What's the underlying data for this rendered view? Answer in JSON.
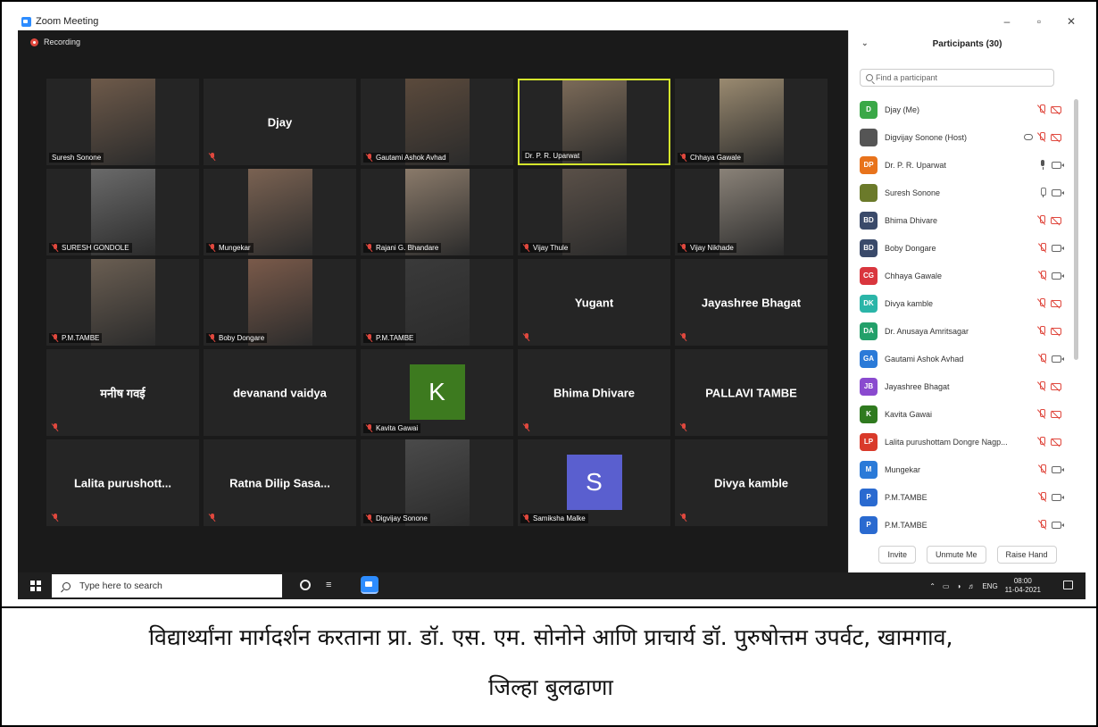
{
  "window": {
    "title": "Zoom Meeting",
    "controls": [
      "–",
      "▫",
      "✕"
    ]
  },
  "recording_label": "Recording",
  "tiles": [
    {
      "label": "Suresh Sonone",
      "big": "",
      "mic_muted": false,
      "active": false,
      "kind": "photo",
      "photo_color": "#6e5a4a"
    },
    {
      "label": "",
      "big": "Djay",
      "mic_muted": true,
      "active": false,
      "kind": "name"
    },
    {
      "label": "Gautami Ashok Avhad",
      "big": "",
      "mic_muted": true,
      "active": false,
      "kind": "photo",
      "photo_color": "#5b4a3c"
    },
    {
      "label": "Dr. P. R. Uparwat",
      "big": "",
      "mic_muted": false,
      "active": true,
      "kind": "photo",
      "photo_color": "#7b6a58"
    },
    {
      "label": "Chhaya Gawale",
      "big": "",
      "mic_muted": true,
      "active": false,
      "kind": "photo",
      "photo_color": "#9a8a70"
    },
    {
      "label": "SURESH GONDOLE",
      "big": "",
      "mic_muted": true,
      "active": false,
      "kind": "photo",
      "photo_color": "#6a6a6a"
    },
    {
      "label": "Mungekar",
      "big": "",
      "mic_muted": true,
      "active": false,
      "kind": "photo",
      "photo_color": "#7a6252"
    },
    {
      "label": "Rajani G. Bhandare",
      "big": "",
      "mic_muted": true,
      "active": false,
      "kind": "photo",
      "photo_color": "#8a7a6a"
    },
    {
      "label": "Vijay Thule",
      "big": "",
      "mic_muted": true,
      "active": false,
      "kind": "photo",
      "photo_color": "#5a5048"
    },
    {
      "label": "Vijay Nikhade",
      "big": "",
      "mic_muted": true,
      "active": false,
      "kind": "photo",
      "photo_color": "#8a8278"
    },
    {
      "label": "P.M.TAMBE",
      "big": "",
      "mic_muted": true,
      "active": false,
      "kind": "photo",
      "photo_color": "#6a5e52"
    },
    {
      "label": "Boby Dongare",
      "big": "",
      "mic_muted": true,
      "active": false,
      "kind": "photo",
      "photo_color": "#7a5a4a"
    },
    {
      "label": "P.M.TAMBE",
      "big": "",
      "mic_muted": true,
      "active": false,
      "kind": "photo",
      "photo_color": "#3a3a3a"
    },
    {
      "label": "",
      "big": "Yugant",
      "mic_muted": true,
      "active": false,
      "kind": "name"
    },
    {
      "label": "",
      "big": "Jayashree Bhagat",
      "mic_muted": true,
      "active": false,
      "kind": "name"
    },
    {
      "label": "",
      "big": "मनीष गवई",
      "mic_muted": true,
      "active": false,
      "kind": "name"
    },
    {
      "label": "",
      "big": "devanand vaidya",
      "mic_muted": false,
      "active": false,
      "kind": "name"
    },
    {
      "label": "Kavita Gawai",
      "big": "",
      "mic_muted": true,
      "active": false,
      "kind": "avatar-k",
      "letter": "K"
    },
    {
      "label": "",
      "big": "Bhima Dhivare",
      "mic_muted": true,
      "active": false,
      "kind": "name"
    },
    {
      "label": "",
      "big": "PALLAVI  TAMBE",
      "mic_muted": true,
      "active": false,
      "kind": "name"
    },
    {
      "label": "",
      "big": "Lalita  purushott...",
      "mic_muted": true,
      "active": false,
      "kind": "name"
    },
    {
      "label": "",
      "big": "Ratna  Dilip  Sasa...",
      "mic_muted": true,
      "active": false,
      "kind": "name"
    },
    {
      "label": "Digvijay Sonone",
      "big": "",
      "mic_muted": true,
      "active": false,
      "kind": "photo",
      "photo_color": "#4a4a4a"
    },
    {
      "label": "Samiksha Malke",
      "big": "",
      "mic_muted": true,
      "active": false,
      "kind": "avatar-s",
      "letter": "S"
    },
    {
      "label": "",
      "big": "Divya  kamble",
      "mic_muted": true,
      "active": false,
      "kind": "name"
    }
  ],
  "panel": {
    "title": "Participants (30)",
    "search_placeholder": "Find a participant",
    "participants": [
      {
        "initials": "D",
        "color": "#3aa847",
        "name": "Djay (Me)",
        "mic": "off",
        "cam": "off"
      },
      {
        "initials": "",
        "color": "#555555",
        "name": "Digvijay Sonone (Host)",
        "mic": "off",
        "cam": "off",
        "host": true
      },
      {
        "initials": "DP",
        "color": "#e8731c",
        "name": "Dr. P. R. Uparwat",
        "mic": "on",
        "cam": "on"
      },
      {
        "initials": "",
        "color": "#6b7a2a",
        "name": "Suresh Sonone",
        "mic": "outline",
        "cam": "on"
      },
      {
        "initials": "BD",
        "color": "#3a4a6a",
        "name": "Bhima Dhivare",
        "mic": "off",
        "cam": "off"
      },
      {
        "initials": "BD",
        "color": "#3a4a6a",
        "name": "Boby Dongare",
        "mic": "off",
        "cam": "on"
      },
      {
        "initials": "CG",
        "color": "#d9363e",
        "name": "Chhaya Gawale",
        "mic": "off",
        "cam": "on"
      },
      {
        "initials": "DK",
        "color": "#2bb5a8",
        "name": "Divya  kamble",
        "mic": "off",
        "cam": "off"
      },
      {
        "initials": "DA",
        "color": "#23a06a",
        "name": "Dr. Anusaya Amritsagar",
        "mic": "off",
        "cam": "off"
      },
      {
        "initials": "GA",
        "color": "#2a7ad8",
        "name": "Gautami Ashok Avhad",
        "mic": "off",
        "cam": "on"
      },
      {
        "initials": "JB",
        "color": "#8a4acf",
        "name": "Jayashree Bhagat",
        "mic": "off",
        "cam": "off"
      },
      {
        "initials": "K",
        "color": "#2f7a1f",
        "name": "Kavita Gawai",
        "mic": "off",
        "cam": "off"
      },
      {
        "initials": "LP",
        "color": "#d93a2a",
        "name": "Lalita purushottam Dongre Nagp...",
        "mic": "off",
        "cam": "off"
      },
      {
        "initials": "M",
        "color": "#2a7ad8",
        "name": "Mungekar",
        "mic": "off",
        "cam": "on"
      },
      {
        "initials": "P",
        "color": "#2a6ad0",
        "name": "P.M.TAMBE",
        "mic": "off",
        "cam": "on"
      },
      {
        "initials": "P",
        "color": "#2a6ad0",
        "name": "P.M.TAMBE",
        "mic": "off",
        "cam": "on"
      }
    ],
    "buttons": {
      "invite": "Invite",
      "unmute": "Unmute Me",
      "raise": "Raise Hand"
    }
  },
  "taskbar": {
    "search_placeholder": "Type here to search",
    "lang": "ENG",
    "time": "08:00",
    "date": "11-04-2021"
  },
  "caption": {
    "line1": "विद्यार्थ्यांना मार्गदर्शन करताना प्रा. डॉ. एस. एम. सोनोने आणि प्राचार्य डॉ. पुरुषोत्तम उपर्वट, खामगाव,",
    "line2": "जिल्हा बुलढाणा"
  },
  "colors": {
    "active_speaker": "#d5e62c",
    "zoom_blue": "#2d8cff",
    "muted_red": "#e0483e"
  }
}
